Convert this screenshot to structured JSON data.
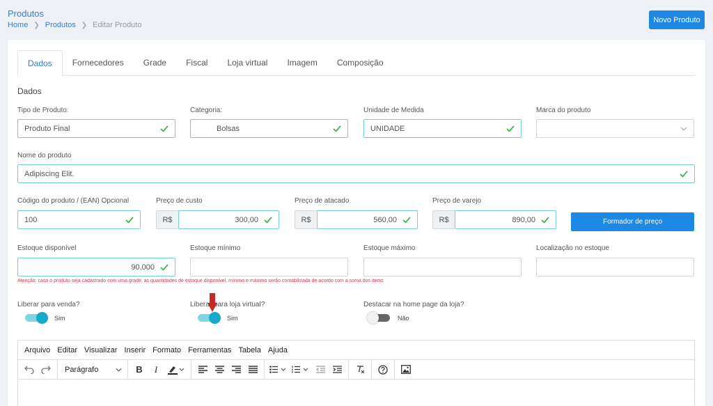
{
  "header": {
    "title": "Produtos",
    "breadcrumb": {
      "home": "Home",
      "produtos": "Produtos",
      "current": "Editar Produto"
    },
    "new_button": "Novo Produto"
  },
  "tabs": [
    "Dados",
    "Fornecedores",
    "Grade",
    "Fiscal",
    "Loja virtual",
    "Imagem",
    "Composição"
  ],
  "section_title": "Dados",
  "fields": {
    "tipo": {
      "label": "Tipo de Produto:",
      "value": "Produto Final"
    },
    "categoria": {
      "label": "Categoria:",
      "value": "Bolsas"
    },
    "unidade": {
      "label": "Unidade de Medida",
      "value": "UNIDADE"
    },
    "marca": {
      "label": "Marca do produto",
      "value": ""
    },
    "nome": {
      "label": "Nome do produto",
      "value": "Adipiscing Elit."
    },
    "codigo": {
      "label": "Código do produto / (EAN) Opcional",
      "value": "100"
    },
    "custo": {
      "label": "Preço de custo",
      "prefix": "R$",
      "value": "300,00"
    },
    "atacado": {
      "label": "Preço de atacado",
      "prefix": "R$",
      "value": "560,00"
    },
    "varejo": {
      "label": "Preço de varejo",
      "prefix": "R$",
      "value": "890,00"
    },
    "estoque_disp": {
      "label": "Estoque disponível",
      "value": "90,000"
    },
    "estoque_min": {
      "label": "Estoque mínimo",
      "value": ""
    },
    "estoque_max": {
      "label": "Estoque máximo",
      "value": ""
    },
    "localizacao": {
      "label": "Localização no estoque",
      "value": ""
    }
  },
  "formador_button": "Formador de preço",
  "warning": "Atenção: caso o produto seja cadastrado com uma grade, as quantidades de estoque disponível, mínimo e máximo serão contabilizada de acordo com a soma dos items",
  "toggles": {
    "venda": {
      "label": "Liberar para venda?",
      "state": "Sim",
      "on": true
    },
    "loja": {
      "label": "Liberar para loja virtual?",
      "state": "Sim",
      "on": true
    },
    "destacar": {
      "label": "Destacar na home page da loja?",
      "state": "Não",
      "on": false
    }
  },
  "editor": {
    "menu": [
      "Arquivo",
      "Editar",
      "Visualizar",
      "Inserir",
      "Formato",
      "Ferramentas",
      "Tabela",
      "Ajuda"
    ],
    "format_select": "Parágrafo"
  },
  "colors": {
    "accent": "#1e88e5",
    "valid": "#4caf50",
    "toggle_on": "#17a9c9",
    "warning": "#e5354b",
    "arrow": "#c62828"
  }
}
